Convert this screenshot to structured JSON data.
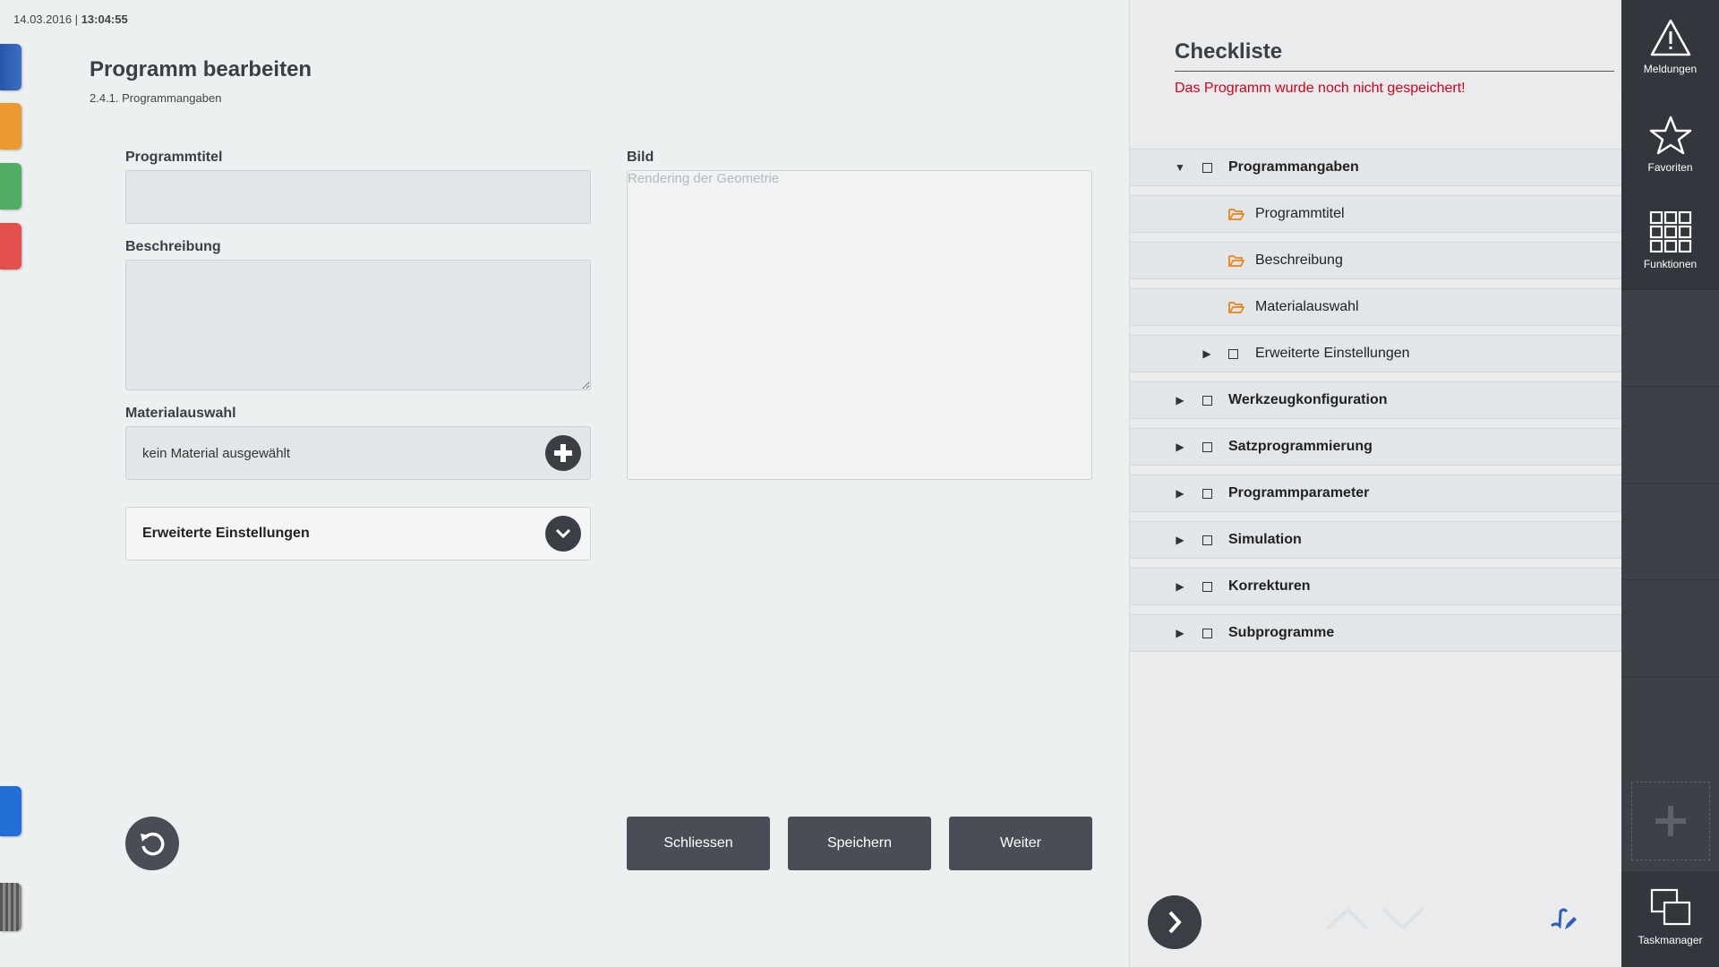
{
  "status": {
    "date": "14.03.2016 |",
    "time": "13:04:55"
  },
  "main": {
    "title": "Programm bearbeiten",
    "breadcrumb": "2.4.1. Programmangaben",
    "fields": {
      "title_label": "Programmtitel",
      "title_value": "",
      "description_label": "Beschreibung",
      "description_value": "",
      "material_label": "Materialauswahl",
      "material_value": "kein Material ausgewählt",
      "advanced_label": "Erweiterte Einstellungen",
      "image_label": "Bild",
      "image_placeholder": "Rendering der Geometrie"
    },
    "buttons": {
      "close": "Schliessen",
      "save": "Speichern",
      "next": "Weiter"
    }
  },
  "checklist": {
    "title": "Checkliste",
    "warning": "Das Programm wurde noch nicht gespeichert!",
    "items": [
      {
        "label": "Programmangaben",
        "expanded": true
      },
      {
        "label": "Programmtitel"
      },
      {
        "label": "Beschreibung"
      },
      {
        "label": "Materialauswahl"
      },
      {
        "label": "Erweiterte Einstellungen",
        "expanded": false
      },
      {
        "label": "Werkzeugkonfiguration",
        "expanded": false
      },
      {
        "label": "Satzprogrammierung",
        "expanded": false
      },
      {
        "label": "Programmparameter",
        "expanded": false
      },
      {
        "label": "Simulation",
        "expanded": false
      },
      {
        "label": "Korrekturen",
        "expanded": false
      },
      {
        "label": "Subprogramme",
        "expanded": false
      }
    ]
  },
  "sidebar": {
    "messages": "Meldungen",
    "favorites": "Favoriten",
    "functions": "Funktionen",
    "taskmanager": "Taskmanager"
  },
  "colors": {
    "dark": "#3b3e45",
    "warning": "#d0021b",
    "folder": "#e8851c",
    "sidebar": "#3d4047",
    "accent_blue": "#2b5fb8"
  },
  "left_tabs": [
    "blue-ruler",
    "orange",
    "green",
    "red",
    "blue",
    "striped"
  ]
}
